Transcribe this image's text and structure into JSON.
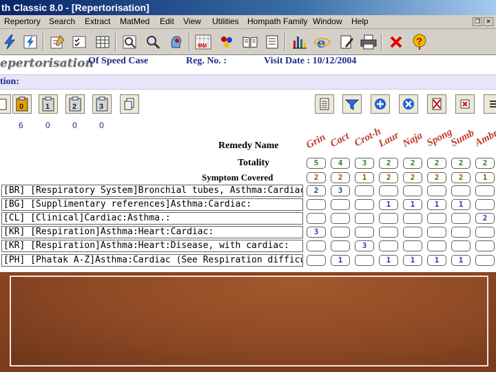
{
  "window": {
    "title": "th Classic 8.0 - [Repertorisation]"
  },
  "menu": {
    "items": [
      "Repertory",
      "Search",
      "Extract",
      "MatMed",
      "Edit",
      "View",
      "Utilities",
      "Hompath Family",
      "Window",
      "Help"
    ],
    "restore_glyph": "❐",
    "close_glyph": "✕"
  },
  "toolbar": {
    "icons": [
      "lightning-icon",
      "lightning-doc-icon",
      "edit-notes-icon",
      "checklist-icon",
      "grid-icon",
      "search-chart-icon",
      "magnify-icon",
      "head-icon",
      "mm-calendar-icon",
      "molecule-icon",
      "book-icon",
      "notes-icon",
      "bar-chart-icon",
      "internet-explorer-icon",
      "document-pen-icon",
      "printer-icon",
      "close-icon",
      "help-icon"
    ],
    "mm_label": "MM"
  },
  "header": {
    "title": "epertorisation",
    "case_label": "Of Speed Case",
    "reg_label": "Reg. No. :",
    "visit_label": "Visit Date : 10/12/2004"
  },
  "notes": {
    "label": "tion:"
  },
  "subtoolbar": {
    "numbered_buttons": [
      "0",
      "1",
      "2",
      "3"
    ],
    "counts": [
      "6",
      "0",
      "0",
      "0"
    ]
  },
  "grid": {
    "remedy_name_label": "Remedy Name",
    "totality_label": "Totality",
    "symptom_covered_label": "Symptom Covered",
    "remedies": [
      "Grin",
      "Cact",
      "Crot-h",
      "Laur",
      "Naja",
      "Spong",
      "Sumb",
      "Ambr"
    ],
    "totality": [
      "5",
      "4",
      "3",
      "2",
      "2",
      "2",
      "2",
      "2"
    ],
    "symptom_covered": [
      "2",
      "2",
      "1",
      "2",
      "2",
      "2",
      "2",
      "1"
    ],
    "rubrics": [
      {
        "text": "[BR] [Respiratory System]Bronchial tubes, Asthma:Cardiac:",
        "grades": [
          "2",
          "3",
          "",
          "",
          "",
          "",
          "",
          ""
        ]
      },
      {
        "text": "[BG] [Supplimentary references]Asthma:Cardiac:",
        "grades": [
          "",
          "",
          "",
          "1",
          "1",
          "1",
          "1",
          ""
        ]
      },
      {
        "text": "[CL] [Clinical]Cardiac:Asthma.:",
        "grades": [
          "",
          "",
          "",
          "",
          "",
          "",
          "",
          "2"
        ]
      },
      {
        "text": "[KR] [Respiration]Asthma:Heart:Cardiac:",
        "grades": [
          "3",
          "",
          "",
          "",
          "",
          "",
          "",
          ""
        ]
      },
      {
        "text": "[KR] [Respiration]Asthma:Heart:Disease, with cardiac:",
        "grades": [
          "",
          "",
          "3",
          "",
          "",
          "",
          "",
          ""
        ]
      },
      {
        "text": "[PH] [Phatak A-Z]Asthma:Cardiac (See Respiration difficult):",
        "grades": [
          "",
          "1",
          "",
          "1",
          "1",
          "1",
          "1",
          ""
        ]
      }
    ]
  },
  "colors": {
    "title_bar": "#0a246a",
    "header_text": "#1a2c8c",
    "remedy_names": "#c0392b",
    "totality": "#2e7d32",
    "covered": "#8b5a00",
    "grades": "#1f3fb4",
    "overlay": "#8a4522"
  }
}
